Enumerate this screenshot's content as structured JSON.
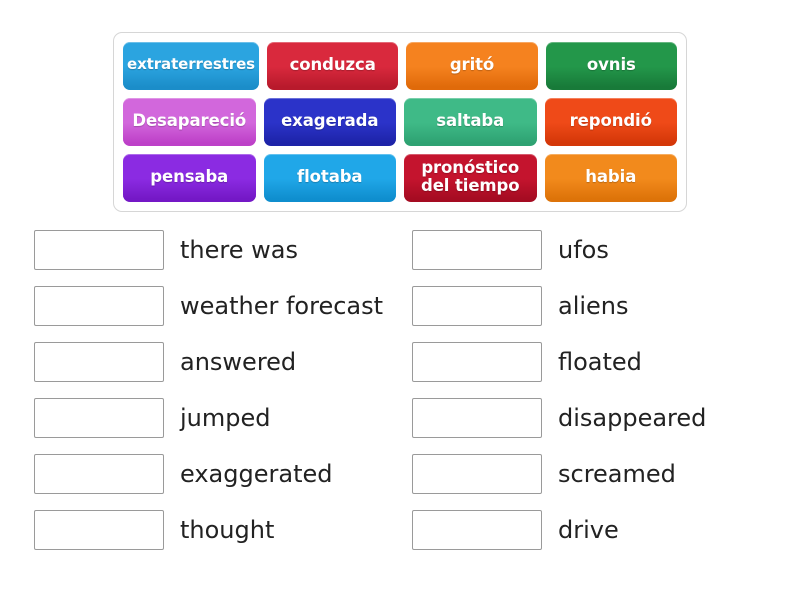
{
  "activity": {
    "type": "match-up",
    "tile_bank": {
      "rows": [
        [
          {
            "label": "extraterrestres",
            "color": "#2ba4e0",
            "color_dark": "#1b8dc9",
            "small": true
          },
          {
            "label": "conduzca",
            "color": "#d9293d",
            "color_dark": "#b81a2c",
            "small": false
          },
          {
            "label": "gritó",
            "color": "#f5821f",
            "color_dark": "#e06a0a",
            "small": false
          },
          {
            "label": "ovnis",
            "color": "#23974a",
            "color_dark": "#187a39",
            "small": false
          }
        ],
        [
          {
            "label": "Desapareció",
            "color": "#d267dc",
            "color_dark": "#bd40c8",
            "small": false
          },
          {
            "label": "exagerada",
            "color": "#2b33c9",
            "color_dark": "#1d23a8",
            "small": false
          },
          {
            "label": "saltaba",
            "color": "#3fba87",
            "color_dark": "#2ea272",
            "small": false
          },
          {
            "label": "repondió",
            "color": "#ef4a18",
            "color_dark": "#d43708",
            "small": false
          }
        ],
        [
          {
            "label": "pensaba",
            "color": "#8b2be2",
            "color_dark": "#7418c6",
            "small": false
          },
          {
            "label": "flotaba",
            "color": "#20a7e8",
            "color_dark": "#0f8ece",
            "small": false
          },
          {
            "label": "pronóstico del tiempo",
            "color": "#c4142e",
            "color_dark": "#a50c22",
            "small": false
          },
          {
            "label": "habia",
            "color": "#f28a1c",
            "color_dark": "#dd7309",
            "small": false
          }
        ]
      ]
    },
    "answers": {
      "left_column": [
        {
          "label": "there was",
          "value": ""
        },
        {
          "label": "weather forecast",
          "value": ""
        },
        {
          "label": "answered",
          "value": ""
        },
        {
          "label": "jumped",
          "value": ""
        },
        {
          "label": "exaggerated",
          "value": ""
        },
        {
          "label": "thought",
          "value": ""
        }
      ],
      "right_column": [
        {
          "label": "ufos",
          "value": ""
        },
        {
          "label": "aliens",
          "value": ""
        },
        {
          "label": "floated",
          "value": ""
        },
        {
          "label": "disappeared",
          "value": ""
        },
        {
          "label": "screamed",
          "value": ""
        },
        {
          "label": "drive",
          "value": ""
        }
      ]
    }
  }
}
